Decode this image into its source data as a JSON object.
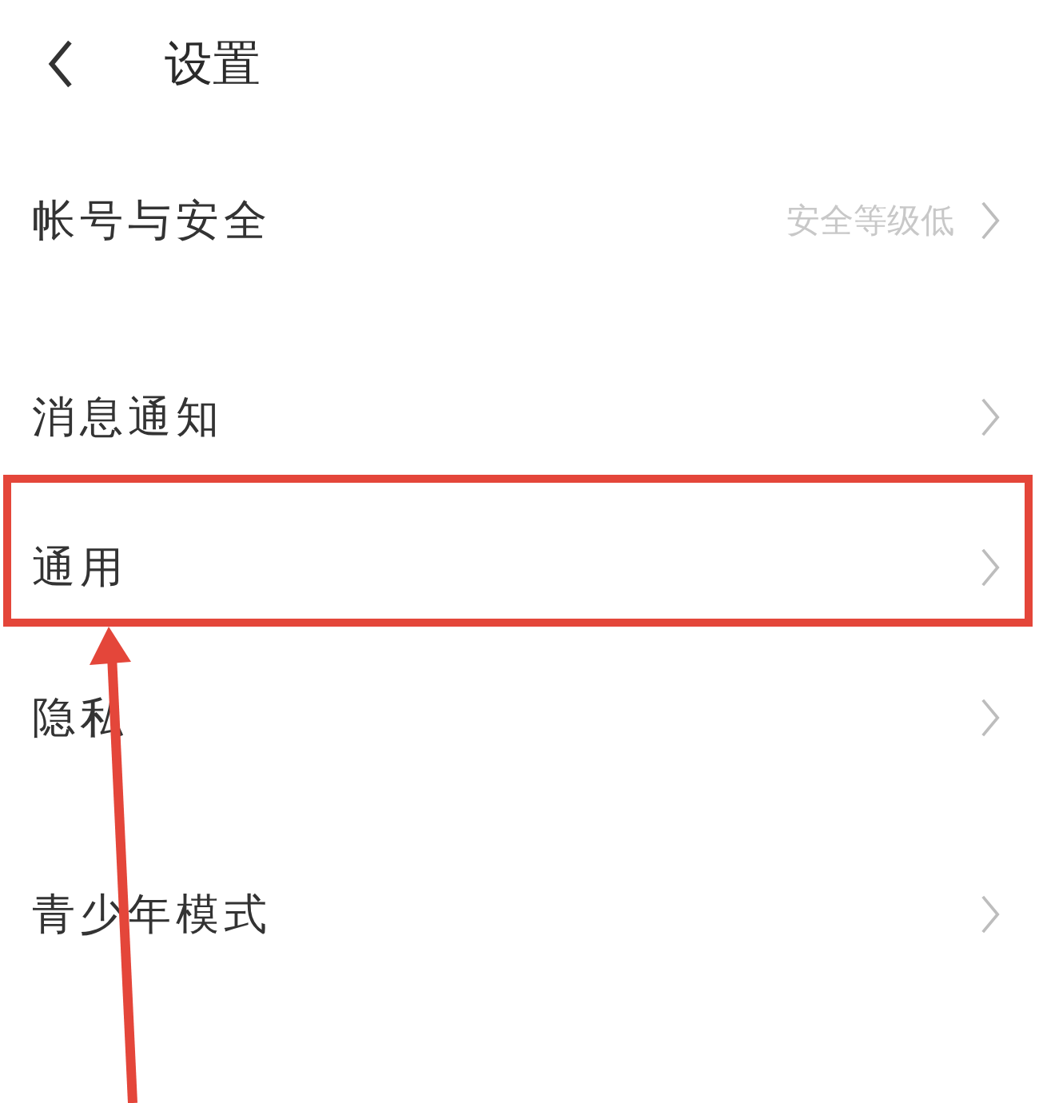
{
  "header": {
    "title": "设置"
  },
  "groups": [
    {
      "items": [
        {
          "label": "帐号与安全",
          "value": "安全等级低",
          "highlighted": false
        }
      ]
    },
    {
      "items": [
        {
          "label": "消息通知",
          "highlighted": false
        },
        {
          "label": "通用",
          "highlighted": true
        },
        {
          "label": "隐私",
          "highlighted": false
        }
      ]
    },
    {
      "items": [
        {
          "label": "青少年模式",
          "highlighted": false
        }
      ]
    }
  ]
}
